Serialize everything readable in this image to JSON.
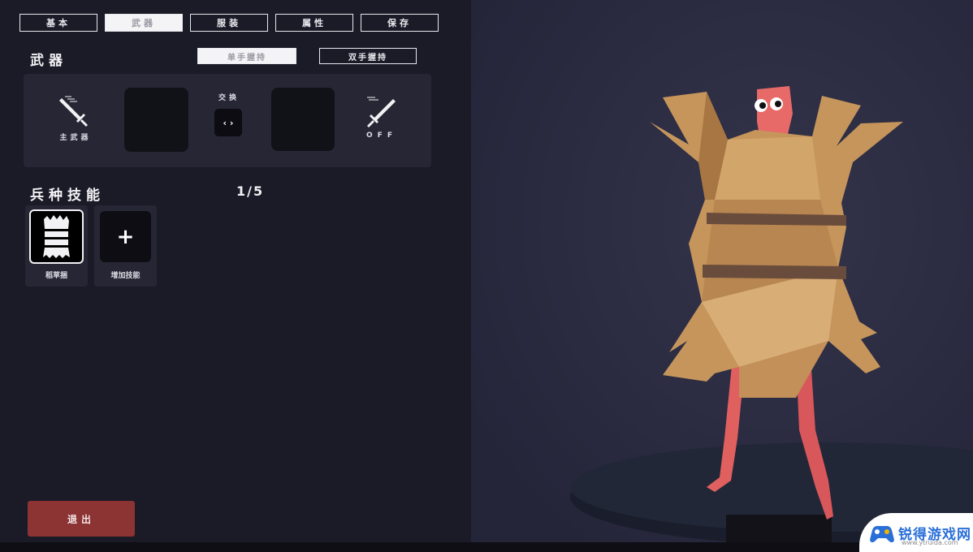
{
  "tabs": [
    {
      "label": "基本",
      "active": false
    },
    {
      "label": "武器",
      "active": true
    },
    {
      "label": "服装",
      "active": false
    },
    {
      "label": "属性",
      "active": false
    },
    {
      "label": "保存",
      "active": false
    }
  ],
  "weapons": {
    "title": "武器",
    "one_hand_label": "单手握持",
    "two_hand_label": "双手握持",
    "main_label": "主武器",
    "swap_label": "交换",
    "swap_glyph": "‹ ›",
    "off_label": "OFF"
  },
  "skills": {
    "title": "兵种技能",
    "count": "1/5",
    "items": [
      {
        "label": "稻草捆",
        "icon": "straw-bundle-icon"
      },
      {
        "label": "增加技能",
        "icon": "plus-icon",
        "glyph": "+"
      }
    ]
  },
  "exit_label": "退出",
  "watermark": {
    "text": "锐得游戏网",
    "url": "www.ytruida.com"
  },
  "colors": {
    "accent_exit": "#8c3333",
    "tab_active_bg": "#f4f4f6",
    "panel_bg": "#272635"
  }
}
